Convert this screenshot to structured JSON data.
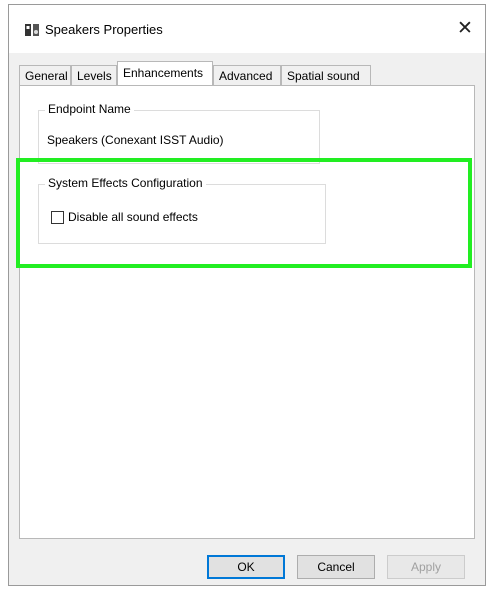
{
  "window": {
    "title": "Speakers Properties",
    "close_glyph": "✕",
    "icon": "speaker-icon"
  },
  "tabs": [
    {
      "label": "General"
    },
    {
      "label": "Levels"
    },
    {
      "label": "Enhancements",
      "active": true
    },
    {
      "label": "Advanced"
    },
    {
      "label": "Spatial sound"
    }
  ],
  "endpoint": {
    "label": "Endpoint Name",
    "value": "Speakers (Conexant ISST Audio)"
  },
  "system_effects": {
    "label": "System Effects Configuration",
    "checkbox_label": "Disable all sound effects",
    "checked": false
  },
  "buttons": {
    "ok": "OK",
    "cancel": "Cancel",
    "apply": "Apply"
  },
  "highlight_color": "#22ee22",
  "accent_color": "#0078d7"
}
